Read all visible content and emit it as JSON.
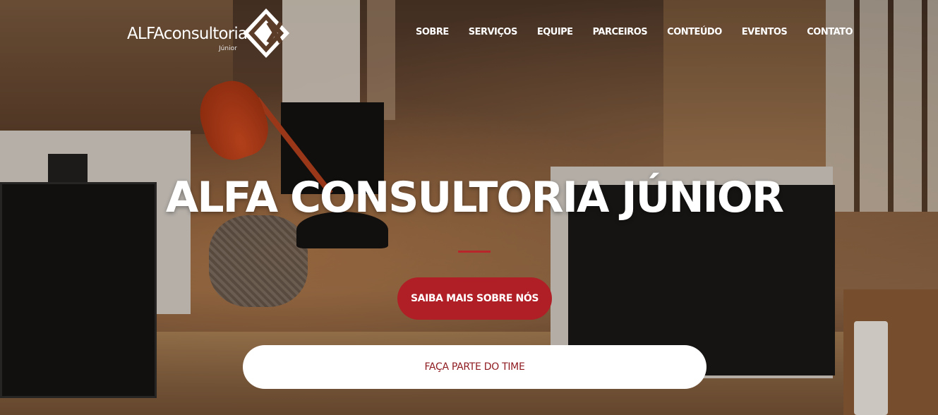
{
  "header": {
    "logo": {
      "brand_bold": "ALFA",
      "brand_rest": "consultoria",
      "subtitle": "Júnior",
      "icon": "alfa-diamond-logo-icon"
    },
    "nav": [
      {
        "label": "SOBRE"
      },
      {
        "label": "SERVIÇOS"
      },
      {
        "label": "EQUIPE"
      },
      {
        "label": "PARCEIROS"
      },
      {
        "label": "CONTEÚDO"
      },
      {
        "label": "EVENTOS"
      },
      {
        "label": "CONTATO"
      }
    ]
  },
  "hero": {
    "title": "ALFA CONSULTORIA JÚNIOR",
    "primary_button": "SAIBA MAIS SOBRE NÓS",
    "secondary_button": "FAÇA PARTE DO TIME"
  },
  "colors": {
    "accent": "#b01f26",
    "divider": "#b8262c",
    "secondary_text": "#8e1a1f",
    "nav_text": "#ffffff"
  }
}
